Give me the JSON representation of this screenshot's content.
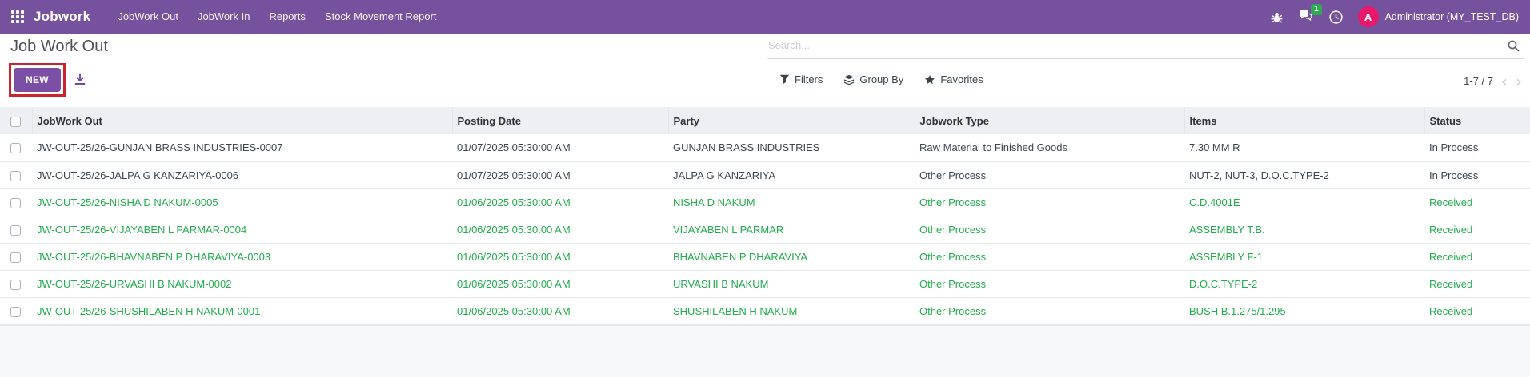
{
  "navbar": {
    "brand": "Jobwork",
    "menu": {
      "jobwork_out": "JobWork Out",
      "jobwork_in": "JobWork In",
      "reports": "Reports",
      "stock_movement_report": "Stock Movement Report"
    },
    "message_badge": "1",
    "avatar_letter": "A",
    "user_name": "Administrator (MY_TEST_DB)"
  },
  "control_panel": {
    "title": "Job Work Out",
    "new_button_label": "NEW",
    "search_placeholder": "Search...",
    "filters_label": "Filters",
    "group_by_label": "Group By",
    "favorites_label": "Favorites",
    "pager_text": "1-7 / 7"
  },
  "table": {
    "headers": {
      "name": "JobWork Out",
      "posting_date": "Posting Date",
      "party": "Party",
      "jobwork_type": "Jobwork Type",
      "items": "Items",
      "status": "Status"
    },
    "rows": [
      {
        "name": "JW-OUT-25/26-GUNJAN BRASS INDUSTRIES-0007",
        "posting_date": "01/07/2025 05:30:00 AM",
        "party": "GUNJAN BRASS INDUSTRIES",
        "jobwork_type": "Raw Material to Finished Goods",
        "items": "7.30 MM R",
        "status": "In Process"
      },
      {
        "name": "JW-OUT-25/26-JALPA G KANZARIYA-0006",
        "posting_date": "01/07/2025 05:30:00 AM",
        "party": "JALPA G KANZARIYA",
        "jobwork_type": "Other Process",
        "items": "NUT-2, NUT-3, D.O.C.TYPE-2",
        "status": "In Process"
      },
      {
        "name": "JW-OUT-25/26-NISHA D NAKUM-0005",
        "posting_date": "01/06/2025 05:30:00 AM",
        "party": "NISHA D NAKUM",
        "jobwork_type": "Other Process",
        "items": "C.D.4001E",
        "status": "Received"
      },
      {
        "name": "JW-OUT-25/26-VIJAYABEN L PARMAR-0004",
        "posting_date": "01/06/2025 05:30:00 AM",
        "party": "VIJAYABEN L PARMAR",
        "jobwork_type": "Other Process",
        "items": "ASSEMBLY T.B.",
        "status": "Received"
      },
      {
        "name": "JW-OUT-25/26-BHAVNABEN P DHARAVIYA-0003",
        "posting_date": "01/06/2025 05:30:00 AM",
        "party": "BHAVNABEN P DHARAVIYA",
        "jobwork_type": "Other Process",
        "items": "ASSEMBLY F-1",
        "status": "Received"
      },
      {
        "name": "JW-OUT-25/26-URVASHI B NAKUM-0002",
        "posting_date": "01/06/2025 05:30:00 AM",
        "party": "URVASHI B NAKUM",
        "jobwork_type": "Other Process",
        "items": "D.O.C.TYPE-2",
        "status": "Received"
      },
      {
        "name": "JW-OUT-25/26-SHUSHILABEN H NAKUM-0001",
        "posting_date": "01/06/2025 05:30:00 AM",
        "party": "SHUSHILABEN H NAKUM",
        "jobwork_type": "Other Process",
        "items": "BUSH B.1.275/1.295",
        "status": "Received"
      }
    ]
  },
  "colors": {
    "navbar_bg": "#76519e",
    "primary_button_bg": "#7a4fa5",
    "highlight_box_red": "#cb2431",
    "received_green": "#21ad4d",
    "default_row_text": "#3d4752",
    "avatar_bg": "#e7196a",
    "message_badge_bg": "#2eac52",
    "header_bg": "#edeff2"
  }
}
